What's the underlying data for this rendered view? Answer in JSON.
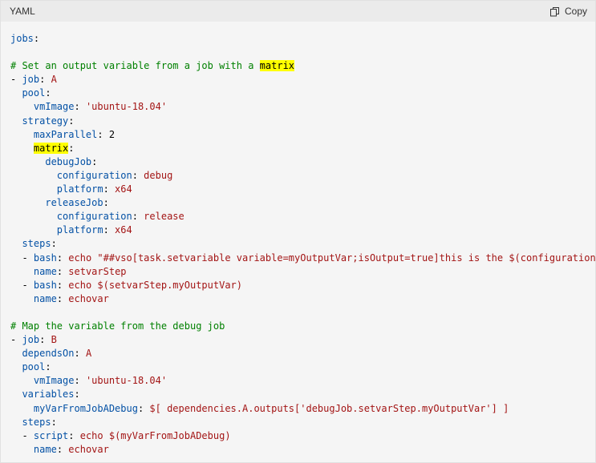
{
  "header": {
    "language": "YAML",
    "copy_label": "Copy",
    "copy_icon": "copy-icon"
  },
  "code": {
    "lines": [
      [
        {
          "t": "k",
          "v": "jobs"
        },
        {
          "t": "p",
          "v": ":"
        }
      ],
      [],
      [
        {
          "t": "c",
          "v": "# Set an output variable from a job with a "
        },
        {
          "t": "hl",
          "v": "matrix"
        }
      ],
      [
        {
          "t": "p",
          "v": "- "
        },
        {
          "t": "k",
          "v": "job"
        },
        {
          "t": "p",
          "v": ": "
        },
        {
          "t": "s",
          "v": "A"
        }
      ],
      [
        {
          "t": "p",
          "v": "  "
        },
        {
          "t": "k",
          "v": "pool"
        },
        {
          "t": "p",
          "v": ":"
        }
      ],
      [
        {
          "t": "p",
          "v": "    "
        },
        {
          "t": "k",
          "v": "vmImage"
        },
        {
          "t": "p",
          "v": ": "
        },
        {
          "t": "s",
          "v": "'ubuntu-18.04'"
        }
      ],
      [
        {
          "t": "p",
          "v": "  "
        },
        {
          "t": "k",
          "v": "strategy"
        },
        {
          "t": "p",
          "v": ":"
        }
      ],
      [
        {
          "t": "p",
          "v": "    "
        },
        {
          "t": "k",
          "v": "maxParallel"
        },
        {
          "t": "p",
          "v": ": 2"
        }
      ],
      [
        {
          "t": "p",
          "v": "    "
        },
        {
          "t": "hl",
          "v": "matrix"
        },
        {
          "t": "p",
          "v": ":"
        }
      ],
      [
        {
          "t": "p",
          "v": "      "
        },
        {
          "t": "k",
          "v": "debugJob"
        },
        {
          "t": "p",
          "v": ":"
        }
      ],
      [
        {
          "t": "p",
          "v": "        "
        },
        {
          "t": "k",
          "v": "configuration"
        },
        {
          "t": "p",
          "v": ": "
        },
        {
          "t": "s",
          "v": "debug"
        }
      ],
      [
        {
          "t": "p",
          "v": "        "
        },
        {
          "t": "k",
          "v": "platform"
        },
        {
          "t": "p",
          "v": ": "
        },
        {
          "t": "s",
          "v": "x64"
        }
      ],
      [
        {
          "t": "p",
          "v": "      "
        },
        {
          "t": "k",
          "v": "releaseJob"
        },
        {
          "t": "p",
          "v": ":"
        }
      ],
      [
        {
          "t": "p",
          "v": "        "
        },
        {
          "t": "k",
          "v": "configuration"
        },
        {
          "t": "p",
          "v": ": "
        },
        {
          "t": "s",
          "v": "release"
        }
      ],
      [
        {
          "t": "p",
          "v": "        "
        },
        {
          "t": "k",
          "v": "platform"
        },
        {
          "t": "p",
          "v": ": "
        },
        {
          "t": "s",
          "v": "x64"
        }
      ],
      [
        {
          "t": "p",
          "v": "  "
        },
        {
          "t": "k",
          "v": "steps"
        },
        {
          "t": "p",
          "v": ":"
        }
      ],
      [
        {
          "t": "p",
          "v": "  - "
        },
        {
          "t": "k",
          "v": "bash"
        },
        {
          "t": "p",
          "v": ": "
        },
        {
          "t": "s",
          "v": "echo \"##vso[task.setvariable variable=myOutputVar;isOutput=true]this is the $(configuration) va"
        }
      ],
      [
        {
          "t": "p",
          "v": "    "
        },
        {
          "t": "k",
          "v": "name"
        },
        {
          "t": "p",
          "v": ": "
        },
        {
          "t": "s",
          "v": "setvarStep"
        }
      ],
      [
        {
          "t": "p",
          "v": "  - "
        },
        {
          "t": "k",
          "v": "bash"
        },
        {
          "t": "p",
          "v": ": "
        },
        {
          "t": "s",
          "v": "echo $(setvarStep.myOutputVar)"
        }
      ],
      [
        {
          "t": "p",
          "v": "    "
        },
        {
          "t": "k",
          "v": "name"
        },
        {
          "t": "p",
          "v": ": "
        },
        {
          "t": "s",
          "v": "echovar"
        }
      ],
      [],
      [
        {
          "t": "c",
          "v": "# Map the variable from the debug job"
        }
      ],
      [
        {
          "t": "p",
          "v": "- "
        },
        {
          "t": "k",
          "v": "job"
        },
        {
          "t": "p",
          "v": ": "
        },
        {
          "t": "s",
          "v": "B"
        }
      ],
      [
        {
          "t": "p",
          "v": "  "
        },
        {
          "t": "k",
          "v": "dependsOn"
        },
        {
          "t": "p",
          "v": ": "
        },
        {
          "t": "s",
          "v": "A"
        }
      ],
      [
        {
          "t": "p",
          "v": "  "
        },
        {
          "t": "k",
          "v": "pool"
        },
        {
          "t": "p",
          "v": ":"
        }
      ],
      [
        {
          "t": "p",
          "v": "    "
        },
        {
          "t": "k",
          "v": "vmImage"
        },
        {
          "t": "p",
          "v": ": "
        },
        {
          "t": "s",
          "v": "'ubuntu-18.04'"
        }
      ],
      [
        {
          "t": "p",
          "v": "  "
        },
        {
          "t": "k",
          "v": "variables"
        },
        {
          "t": "p",
          "v": ":"
        }
      ],
      [
        {
          "t": "p",
          "v": "    "
        },
        {
          "t": "k",
          "v": "myVarFromJobADebug"
        },
        {
          "t": "p",
          "v": ": "
        },
        {
          "t": "s",
          "v": "$[ dependencies.A.outputs['debugJob.setvarStep.myOutputVar'] ]"
        }
      ],
      [
        {
          "t": "p",
          "v": "  "
        },
        {
          "t": "k",
          "v": "steps"
        },
        {
          "t": "p",
          "v": ":"
        }
      ],
      [
        {
          "t": "p",
          "v": "  - "
        },
        {
          "t": "k",
          "v": "script"
        },
        {
          "t": "p",
          "v": ": "
        },
        {
          "t": "s",
          "v": "echo $(myVarFromJobADebug)"
        }
      ],
      [
        {
          "t": "p",
          "v": "    "
        },
        {
          "t": "k",
          "v": "name"
        },
        {
          "t": "p",
          "v": ": "
        },
        {
          "t": "s",
          "v": "echovar"
        }
      ]
    ]
  },
  "colors": {
    "key": "#0451a5",
    "comment": "#008000",
    "string": "#a31515",
    "highlight": "#ffff00",
    "panel_background": "#f5f5f5",
    "header_background": "#ebebeb"
  }
}
